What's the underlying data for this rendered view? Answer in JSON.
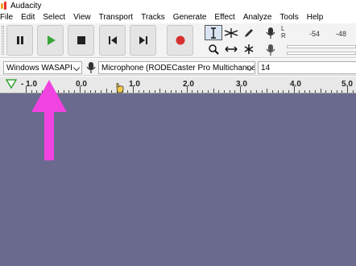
{
  "window": {
    "title": "Audacity"
  },
  "menu": [
    "File",
    "Edit",
    "Select",
    "View",
    "Transport",
    "Tracks",
    "Generate",
    "Effect",
    "Analyze",
    "Tools",
    "Help"
  ],
  "transport": {
    "pause_icon": "pause-icon",
    "play_icon": "play-icon",
    "stop_icon": "stop-icon",
    "skip_start_icon": "skip-to-start-icon",
    "skip_end_icon": "skip-to-end-icon",
    "record_icon": "record-icon"
  },
  "meters": {
    "record_channels": [
      "L",
      "R"
    ],
    "scale": [
      "-54",
      "-48"
    ]
  },
  "device": {
    "host": "Windows WASAPI",
    "recording_device": "Microphone (RODECaster Pro Multichannel)",
    "channels": "14"
  },
  "ruler": {
    "labels": [
      "- 1.0",
      "0.0",
      "1.0",
      "2.0",
      "3.0",
      "4.0",
      "5.0"
    ]
  },
  "colors": {
    "track_background": "#6a6a8e",
    "play_green": "#3aa63a",
    "record_red": "#d63030",
    "annotation_magenta": "#f043e0"
  }
}
